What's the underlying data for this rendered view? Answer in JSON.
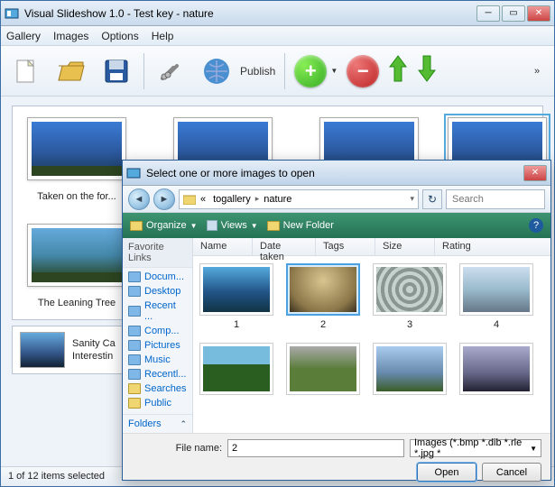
{
  "main": {
    "title": "Visual Slideshow 1.0 - Test key - nature",
    "menus": [
      "Gallery",
      "Images",
      "Options",
      "Help"
    ],
    "publish_label": "Publish",
    "thumbs": [
      {
        "caption": "Taken on the for..."
      },
      {
        "caption": ""
      },
      {
        "caption": ""
      },
      {
        "caption": ""
      }
    ],
    "thumbs2": [
      {
        "caption": "The Leaning Tree"
      }
    ],
    "detail": {
      "line1": "Sanity Ca",
      "line2": "Interestin"
    },
    "status": "1 of 12 items selected"
  },
  "dialog": {
    "title": "Select one or more images to open",
    "breadcrumb": [
      "«",
      "togallery",
      "nature"
    ],
    "search_placeholder": "Search",
    "cmdbar": {
      "organize": "Organize",
      "views": "Views",
      "newfolder": "New Folder"
    },
    "fav_header": "Favorite Links",
    "favs": [
      "Docum...",
      "Desktop",
      "Recent ...",
      "Comp...",
      "Pictures",
      "Music",
      "Recentl...",
      "Searches",
      "Public"
    ],
    "folders_label": "Folders",
    "columns": {
      "name": "Name",
      "date": "Date taken",
      "tags": "Tags",
      "size": "Size",
      "rating": "Rating"
    },
    "files_row1": [
      "1",
      "2",
      "3",
      "4"
    ],
    "filename_label": "File name:",
    "filename_value": "2",
    "filter": "Images (*.bmp *.dib *.rle *.jpg *",
    "open_btn": "Open",
    "cancel_btn": "Cancel"
  }
}
